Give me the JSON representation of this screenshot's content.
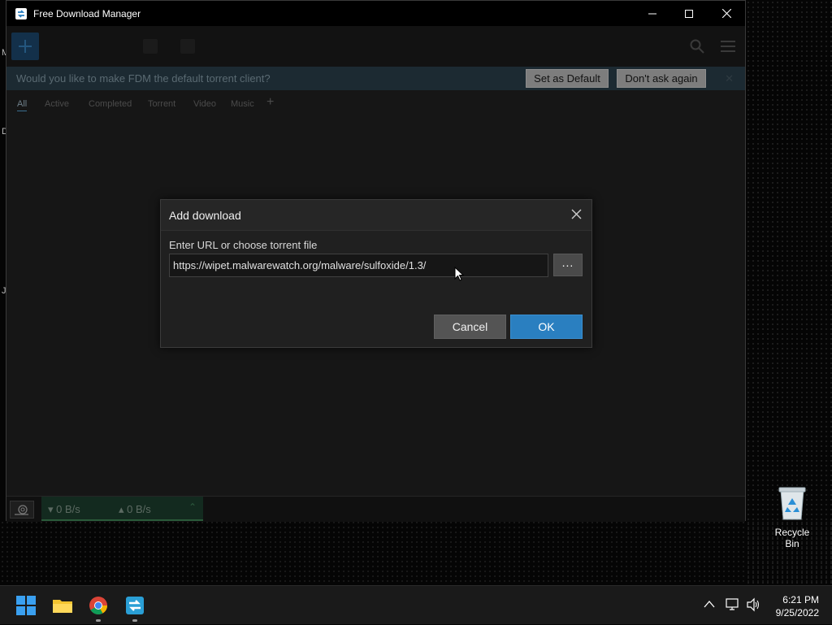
{
  "window": {
    "title": "Free Download Manager",
    "notification": {
      "text": "Would you like to make FDM the default torrent client?",
      "set_default_label": "Set as Default",
      "dont_ask_label": "Don't ask again"
    },
    "filters": [
      "All",
      "Active",
      "Completed",
      "Torrent",
      "Video",
      "Music"
    ],
    "filter_add": "+",
    "status": {
      "download_speed": "0 B/s",
      "upload_speed": "0 B/s"
    }
  },
  "dialog": {
    "title": "Add download",
    "label": "Enter URL or choose torrent file",
    "url_value": "https://wipet.malwarewatch.org/malware/sulfoxide/1.3/",
    "browse_label": "...",
    "cancel_label": "Cancel",
    "ok_label": "OK"
  },
  "desktop": {
    "edge_letters": [
      "M",
      "D",
      "J"
    ],
    "recycle_bin_label": "Recycle Bin"
  },
  "taskbar": {
    "apps": [
      "start-icon",
      "file-explorer-icon",
      "chrome-icon",
      "fdm-icon"
    ],
    "clock": {
      "time": "6:21 PM",
      "date": "9/25/2022"
    }
  },
  "colors": {
    "accent_blue": "#2a7fc0",
    "dialog_bg": "#202020",
    "window_bg": "#161616",
    "notification_bg": "#1c2a32"
  }
}
